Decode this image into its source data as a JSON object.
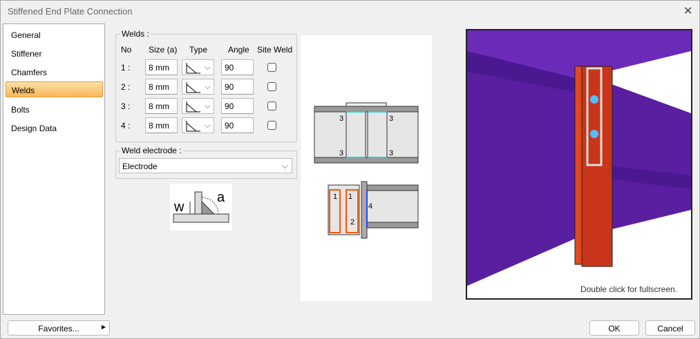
{
  "window": {
    "title": "Stiffened End Plate Connection"
  },
  "nav": {
    "items": [
      {
        "label": "General"
      },
      {
        "label": "Stiffener"
      },
      {
        "label": "Chamfers"
      },
      {
        "label": "Welds",
        "selected": true
      },
      {
        "label": "Bolts"
      },
      {
        "label": "Design Data"
      }
    ]
  },
  "welds": {
    "legend": "Welds :",
    "headers": {
      "no": "No",
      "size": "Size (a)",
      "type": "Type",
      "angle": "Angle",
      "site": "Site Weld"
    },
    "rows": [
      {
        "no": "1 :",
        "size": "8 mm",
        "type": "fillet",
        "angle": "90",
        "site": false
      },
      {
        "no": "2 :",
        "size": "8 mm",
        "type": "fillet",
        "angle": "90",
        "site": false
      },
      {
        "no": "3 :",
        "size": "8 mm",
        "type": "fillet",
        "angle": "90",
        "site": false
      },
      {
        "no": "4 :",
        "size": "8 mm",
        "type": "fillet",
        "angle": "90",
        "site": false
      }
    ]
  },
  "electrode": {
    "legend": "Weld electrode :",
    "value": "Electrode"
  },
  "weld_diagram": {
    "w": "w",
    "a": "a"
  },
  "drawing": {
    "labels": [
      "3",
      "3",
      "3",
      "3",
      "1",
      "1",
      "2",
      "4"
    ]
  },
  "view3d": {
    "hint": "Double click for fullscreen."
  },
  "footer": {
    "favorites": "Favorites...",
    "ok": "OK",
    "cancel": "Cancel"
  }
}
